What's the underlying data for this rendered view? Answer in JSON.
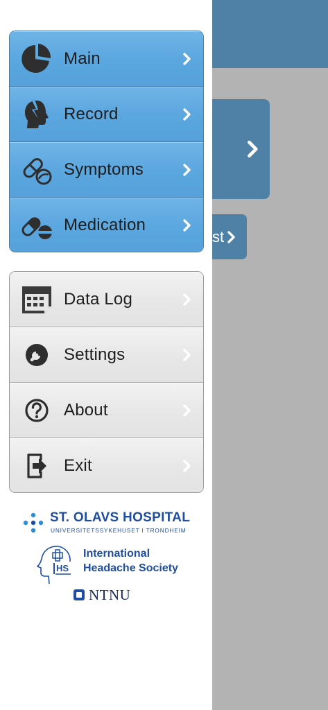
{
  "background": {
    "button_partial_text": "st"
  },
  "menu": {
    "primary_items": [
      {
        "label": "Main",
        "icon": "pie-chart-icon"
      },
      {
        "label": "Record",
        "icon": "headache-head-icon"
      },
      {
        "label": "Symptoms",
        "icon": "pills-icon"
      },
      {
        "label": "Medication",
        "icon": "medication-icon"
      }
    ],
    "secondary_items": [
      {
        "label": "Data Log",
        "icon": "calendar-grid-icon"
      },
      {
        "label": "Settings",
        "icon": "wrench-icon"
      },
      {
        "label": "About",
        "icon": "question-icon"
      },
      {
        "label": "Exit",
        "icon": "exit-icon"
      }
    ]
  },
  "logos": {
    "st_olavs_title": "ST. OLAVS HOSPITAL",
    "st_olavs_subtitle": "UNIVERSITETSSYKEHUSET I TRONDHEIM",
    "ihs_line1": "International",
    "ihs_line2": "Headache Society",
    "ntnu": "NTNU"
  },
  "colors": {
    "primary_menu_blue": "#5aa6df",
    "secondary_menu_grey": "#e6e6e6",
    "background_header_blue": "#4f81a7",
    "background_grey": "#b3b3b3",
    "logo_blue": "#1f4ea0"
  }
}
